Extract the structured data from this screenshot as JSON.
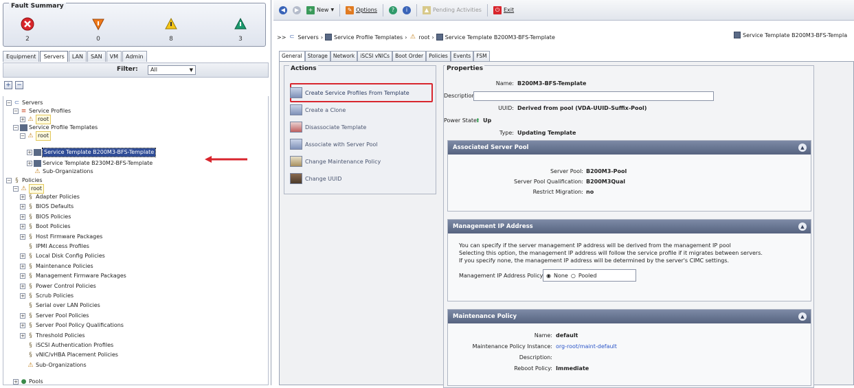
{
  "fault_summary": {
    "title": "Fault Summary",
    "counts": [
      "2",
      "0",
      "8",
      "3"
    ]
  },
  "left_tabs": [
    "Equipment",
    "Servers",
    "LAN",
    "SAN",
    "VM",
    "Admin"
  ],
  "filter": {
    "label": "Filter:",
    "value": "All"
  },
  "tree": {
    "servers": "Servers",
    "service_profiles": "Service Profiles",
    "root1": "root",
    "service_profile_templates": "Service Profile Templates",
    "root2": "root",
    "tpl1": "Service Template B200M3-BFS-Template",
    "tpl2": "Service Template B230M2-BFS-Template",
    "suborg1": "Sub-Organizations",
    "policies": "Policies",
    "root3": "root",
    "policy_items": [
      "Adapter Policies",
      "BIOS Defaults",
      "BIOS Policies",
      "Boot Policies",
      "Host Firmware Packages",
      "IPMI Access Profiles",
      "Local Disk Config Policies",
      "Maintenance Policies",
      "Management Firmware Packages",
      "Power Control Policies",
      "Scrub Policies",
      "Serial over LAN Policies",
      "Server Pool Policies",
      "Server Pool Policy Qualifications",
      "Threshold Policies",
      "iSCSI Authentication Profiles",
      "vNIC/vHBA Placement Policies",
      "Sub-Organizations"
    ],
    "pools": "Pools"
  },
  "toolbar": {
    "new": "New",
    "options": "Options",
    "pending": "Pending Activities",
    "exit": "Exit"
  },
  "breadcrumb": {
    "servers": "Servers",
    "spt": "Service Profile Templates",
    "root": "root",
    "tpl": "Service Template B200M3-BFS-Template",
    "right": "Service Template B200M3-BFS-Templa"
  },
  "right_tabs": [
    "General",
    "Storage",
    "Network",
    "iSCSI vNICs",
    "Boot Order",
    "Policies",
    "Events",
    "FSM"
  ],
  "actions": {
    "title": "Actions",
    "items": [
      "Create Service Profiles From Template",
      "Create a Clone",
      "Disassociate Template",
      "Associate with Server Pool",
      "Change Maintenance Policy",
      "Change UUID"
    ]
  },
  "properties": {
    "title": "Properties",
    "name_label": "Name:",
    "name": "B200M3-BFS-Template",
    "desc_label": "Description:",
    "desc": "",
    "uuid_label": "UUID:",
    "uuid": "Derived from pool (VDA-UUID-Suffix-Pool)",
    "power_label": "Power State:",
    "power": "Up",
    "type_label": "Type:",
    "type": "Updating Template"
  },
  "server_pool": {
    "title": "Associated Server Pool",
    "pool_label": "Server Pool:",
    "pool": "B200M3-Pool",
    "qual_label": "Server Pool Qualification:",
    "qual": "B200M3Qual",
    "restrict_label": "Restrict Migration:",
    "restrict": "no"
  },
  "mgmt_ip": {
    "title": "Management IP Address",
    "line1": "You can specify if the server management IP address will be derived from the management IP pool",
    "line2": "Selecting this option, the management IP address will follow the service profile if it migrates between servers.",
    "line3": "If you specify none, the management IP address will be determined by the server's CIMC settings.",
    "policy_label": "Management IP Address Policy:",
    "opt_none": "None",
    "opt_pooled": "Pooled"
  },
  "maint": {
    "title": "Maintenance Policy",
    "name_label": "Name:",
    "name": "default",
    "instance_label": "Maintenance Policy Instance:",
    "instance": "org-root/maint-default",
    "desc_label": "Description:",
    "reboot_label": "Reboot Policy:",
    "reboot": "Immediate"
  },
  "colors": {
    "highlight": "#2f4c96",
    "red": "#d8252d",
    "section": "#5f6c88"
  }
}
